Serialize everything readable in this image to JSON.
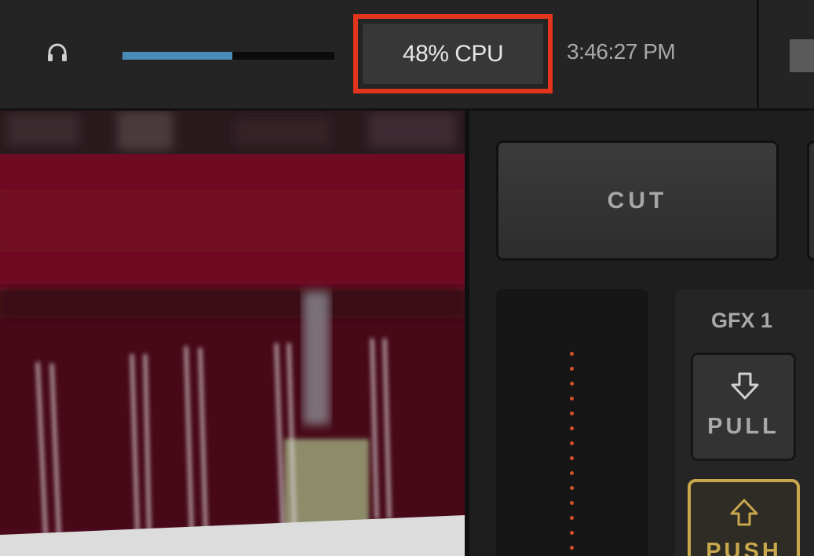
{
  "header": {
    "audio_icon": "headphone-icon",
    "audio_level_fraction": 0.52,
    "cpu_label": "48% CPU",
    "clock": "3:46:27 PM"
  },
  "switcher": {
    "cut_label": "CUT",
    "gfx_title": "GFX 1",
    "pull_label": "PULL",
    "push_label": "PUSH",
    "pull_icon": "arrow-down-icon",
    "push_icon": "arrow-up-icon"
  },
  "colors": {
    "highlight": "#e3341c",
    "meter_fill": "#4b8bb8",
    "push_accent": "#c8a84c",
    "tbar_dots": "#d2502a"
  }
}
